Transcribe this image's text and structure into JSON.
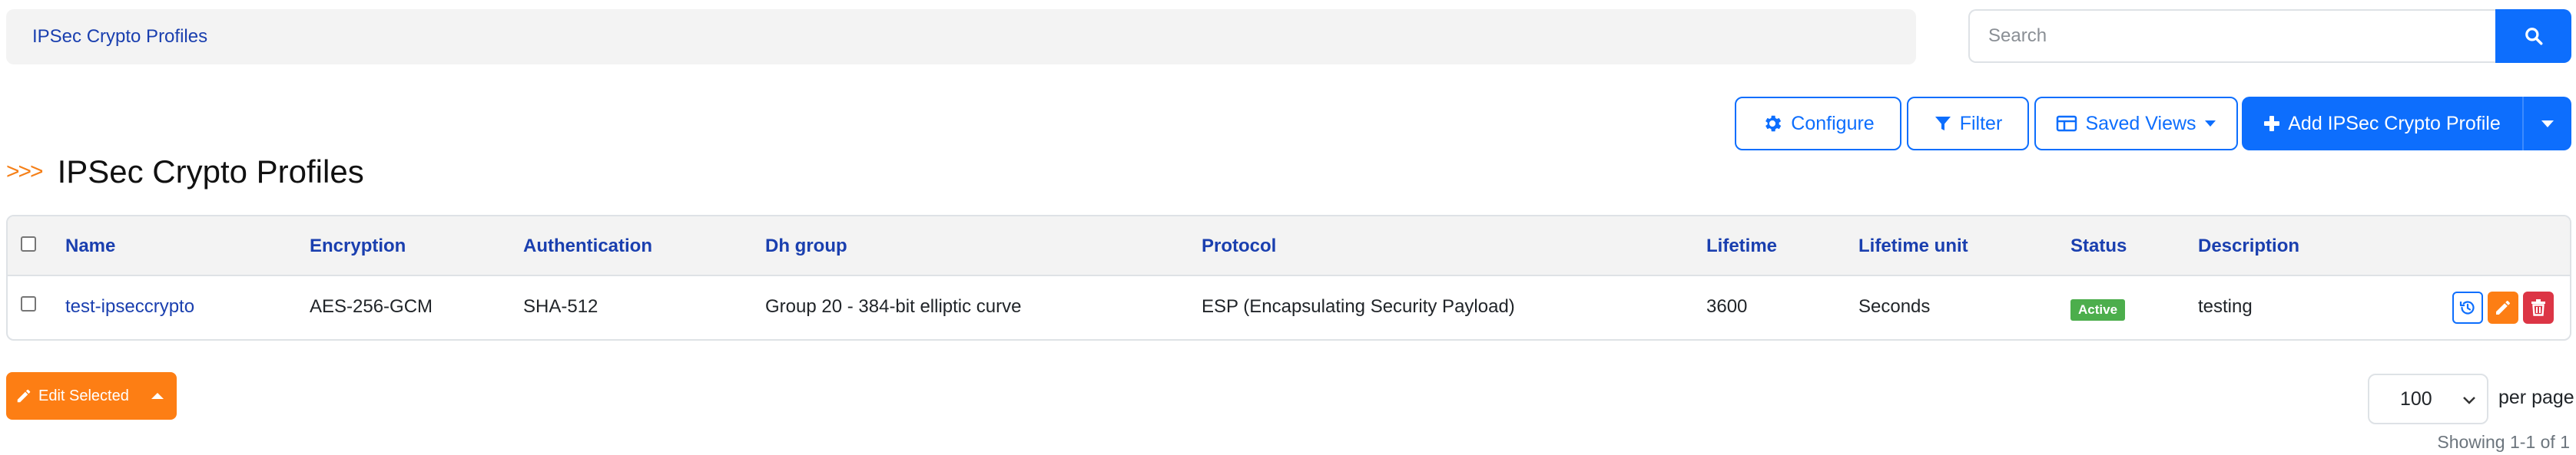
{
  "breadcrumb": {
    "label": "IPSec Crypto Profiles"
  },
  "search": {
    "placeholder": "Search"
  },
  "toolbar": {
    "configure_label": "Configure",
    "filter_label": "Filter",
    "saved_views_label": "Saved Views",
    "add_label": "Add IPSec Crypto Profile"
  },
  "page": {
    "title": "IPSec Crypto Profiles",
    "chevrons": ">>>"
  },
  "table": {
    "columns": {
      "name": "Name",
      "encryption": "Encryption",
      "authentication": "Authentication",
      "dh_group": "Dh group",
      "protocol": "Protocol",
      "lifetime": "Lifetime",
      "lifetime_unit": "Lifetime unit",
      "status": "Status",
      "description": "Description"
    },
    "rows": [
      {
        "name": "test-ipseccrypto",
        "encryption": "AES-256-GCM",
        "authentication": "SHA-512",
        "dh_group": "Group 20 - 384-bit elliptic curve",
        "protocol": "ESP (Encapsulating Security Payload)",
        "lifetime": "3600",
        "lifetime_unit": "Seconds",
        "status": "Active",
        "description": "testing"
      }
    ]
  },
  "footer": {
    "edit_selected_label": "Edit Selected",
    "per_page_value": "100",
    "per_page_label": "per page",
    "showing_text": "Showing 1-1 of 1"
  },
  "colors": {
    "primary": "#0d6efd",
    "link": "#1a3faf",
    "accent_orange": "#fd7e14",
    "danger": "#dc3545",
    "success": "#4cae4c"
  }
}
